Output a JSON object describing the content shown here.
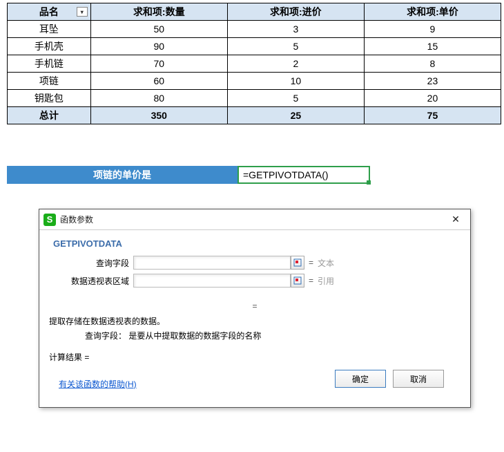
{
  "pivot": {
    "headers": [
      "品名",
      "求和项:数量",
      "求和项:进价",
      "求和项:单价"
    ],
    "rows": [
      {
        "name": "耳坠",
        "qty": "50",
        "cost": "3",
        "price": "9"
      },
      {
        "name": "手机壳",
        "qty": "90",
        "cost": "5",
        "price": "15"
      },
      {
        "name": "手机链",
        "qty": "70",
        "cost": "2",
        "price": "8"
      },
      {
        "name": "项链",
        "qty": "60",
        "cost": "10",
        "price": "23"
      },
      {
        "name": "钥匙包",
        "qty": "80",
        "cost": "5",
        "price": "20"
      }
    ],
    "total": {
      "label": "总计",
      "qty": "350",
      "cost": "25",
      "price": "75"
    }
  },
  "row2": {
    "label": "项链的单价是",
    "formula": "=GETPIVOTDATA()"
  },
  "dialog": {
    "title": "函数参数",
    "func_name": "GETPIVOTDATA",
    "params": [
      {
        "label": "查询字段",
        "value": "",
        "eq": "=",
        "hint": "文本"
      },
      {
        "label": "数据透视表区域",
        "value": "",
        "eq": "=",
        "hint": "引用"
      }
    ],
    "mid_eq": "=",
    "desc_main": "提取存储在数据透视表的数据。",
    "desc_sub": "查询字段： 是要从中提取数据的数据字段的名称",
    "result_label": "计算结果 =",
    "help_text": "有关该函数的帮助(H)",
    "ok": "确定",
    "cancel": "取消"
  }
}
